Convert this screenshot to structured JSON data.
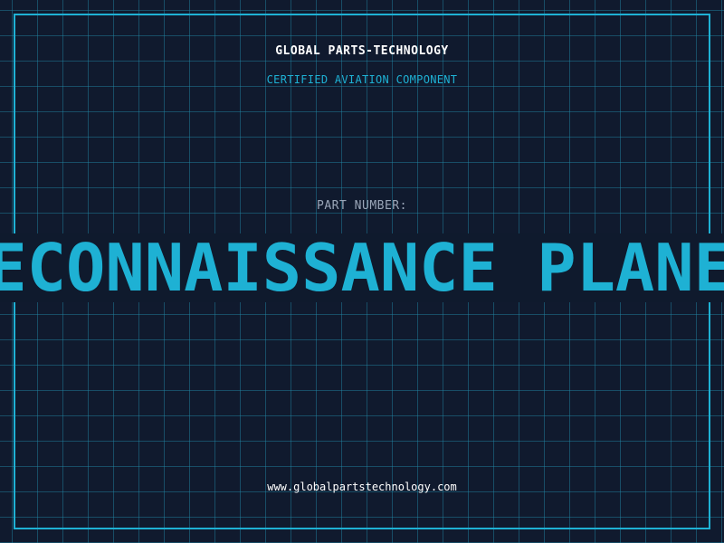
{
  "header": {
    "company": "GLOBAL PARTS-TECHNOLOGY",
    "subtitle": "CERTIFIED AVIATION COMPONENT"
  },
  "part": {
    "label": "PART NUMBER:",
    "value": "RECONNAISSANCE PLANE"
  },
  "footer": {
    "website": "www.globalpartstechnology.com"
  },
  "colors": {
    "background": "#101a2e",
    "accent": "#1eb1d4",
    "grid": "#228caa",
    "label": "#9aa6b8",
    "text": "#ffffff"
  }
}
